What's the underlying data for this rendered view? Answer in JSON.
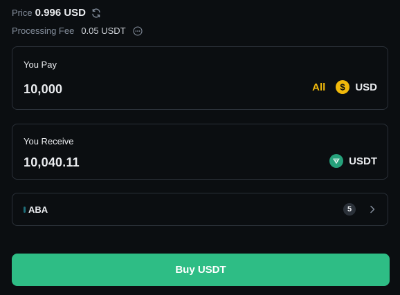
{
  "price": {
    "label": "Price",
    "value": "0.996 USD",
    "refresh_icon": "refresh-icon"
  },
  "fee": {
    "label": "Processing Fee",
    "value": "0.05 USDT",
    "more_icon": "more-icon"
  },
  "pay": {
    "label": "You Pay",
    "amount": "10,000",
    "all_label": "All",
    "currency": "USD",
    "currency_icon": "usd-coin-icon",
    "currency_color": "#f0b90b"
  },
  "receive": {
    "label": "You Receive",
    "amount": "10,040.11",
    "currency": "USDT",
    "currency_icon": "usdt-tether-icon",
    "currency_color": "#26a17b"
  },
  "payment_method": {
    "name": "ABA",
    "count": "5",
    "chevron_icon": "chevron-right-icon"
  },
  "buy_button": {
    "label": "Buy USDT",
    "color": "#2ebd85"
  }
}
